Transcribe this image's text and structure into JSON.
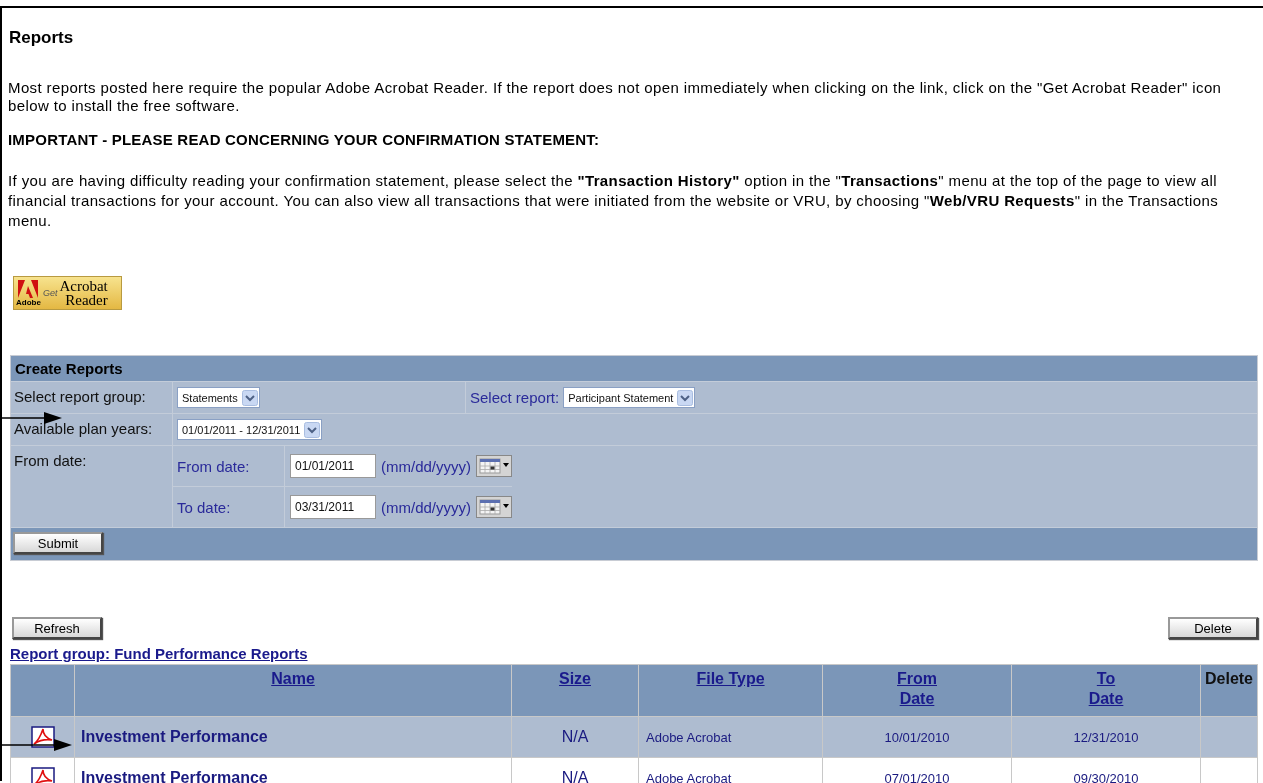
{
  "heading": "Reports",
  "intro": "Most reports posted here require the popular Adobe Acrobat Reader.  If the report does not open immediately when clicking on the link, click on the \"Get Acrobat Reader\" icon below to install the free software.",
  "notice_title": "IMPORTANT - PLEASE READ CONCERNING YOUR CONFIRMATION STATEMENT:",
  "notice": "If you are having difficulty reading your confirmation statement, please select the **\"Transaction History\"** option in the \"**Transactions**\" menu at the top of the page to view all financial transactions for your account. You can also view all transactions that were initiated from the website or VRU, by choosing \"**Web/VRU Requests**\" in the Transactions menu.",
  "reader_badge": {
    "brand": "Adobe",
    "get": "Get",
    "line_1": "Acrobat",
    "line_2": "Reader"
  },
  "create_reports": {
    "title": "Create Reports",
    "report_group": {
      "label": "Select report group:",
      "value": "Statements"
    },
    "report": {
      "label": "Select report:",
      "value": "Participant Statement"
    },
    "plan_years": {
      "label": "Available plan years:",
      "value": "01/01/2011 - 12/31/2011"
    },
    "date_range_label": "From date:",
    "from": {
      "label": "From date:",
      "value": "01/01/2011",
      "format": "(mm/dd/yyyy)"
    },
    "to": {
      "label": "To date:",
      "value": "03/31/2011",
      "format": "(mm/dd/yyyy)"
    },
    "submit": "Submit"
  },
  "refresh_button": "Refresh",
  "delete_button": "Delete",
  "report_group_link": "Report group: Fund Performance Reports",
  "table": {
    "columns": [
      {
        "lines": [
          "Name"
        ],
        "sortable": true
      },
      {
        "lines": [
          "Size"
        ],
        "sortable": true
      },
      {
        "lines": [
          "File Type"
        ],
        "sortable": true
      },
      {
        "lines": [
          "From",
          "Date"
        ],
        "sortable": true
      },
      {
        "lines": [
          "To",
          "Date"
        ],
        "sortable": true
      },
      {
        "lines": [
          "Delete"
        ],
        "sortable": false
      }
    ],
    "rows": [
      {
        "name": "Investment Performance",
        "size": "N/A",
        "file_type": "Adobe Acrobat",
        "from": "10/01/2010",
        "to": "12/31/2010",
        "selected": true
      },
      {
        "name": "Investment Performance",
        "size": "N/A",
        "file_type": "Adobe Acrobat",
        "from": "07/01/2010",
        "to": "09/30/2010",
        "selected": false
      }
    ]
  }
}
